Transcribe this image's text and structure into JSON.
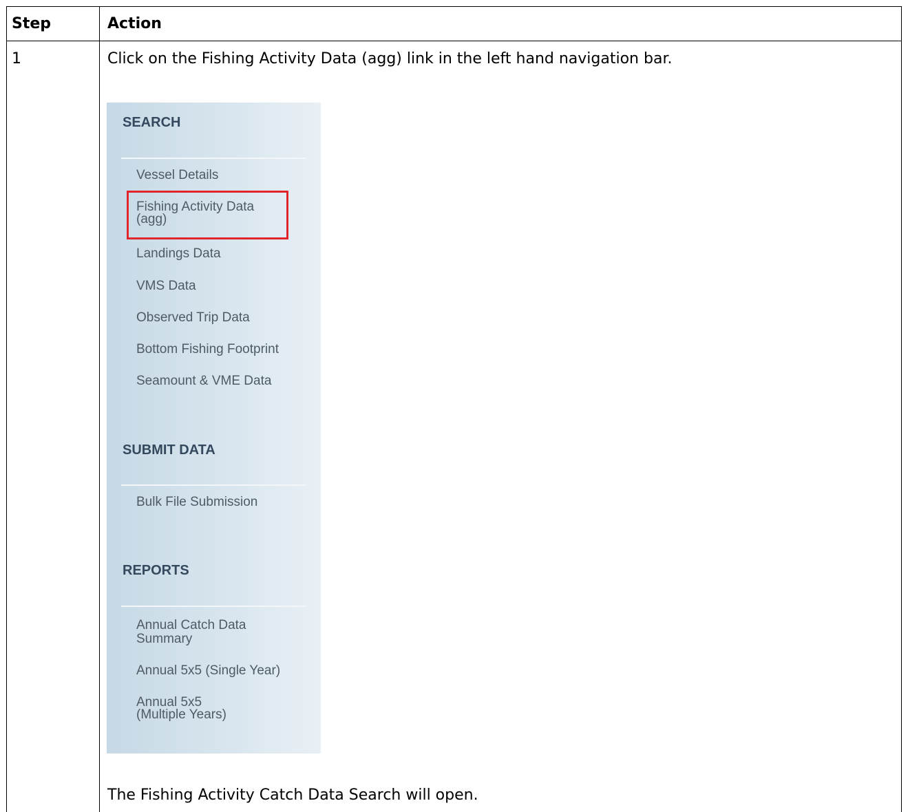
{
  "table": {
    "header": {
      "step": "Step",
      "action": "Action"
    },
    "row": {
      "step": "1",
      "instruction": "Click on the Fishing Activity Data (agg) link in the left hand navigation bar.",
      "result": "The Fishing Activity Catch Data Search will open."
    }
  },
  "nav": {
    "search": {
      "title": "SEARCH",
      "items": [
        "Vessel Details",
        "Fishing Activity Data",
        "(agg)",
        "Landings Data",
        "VMS Data",
        "Observed Trip Data",
        "Bottom Fishing Footprint",
        "Seamount & VME Data"
      ]
    },
    "submit": {
      "title": "SUBMIT DATA",
      "items": [
        "Bulk File Submission"
      ]
    },
    "reports": {
      "title": "REPORTS",
      "items": [
        "Annual Catch Data",
        "Summary",
        "Annual 5x5 (Single Year)",
        "Annual 5x5",
        "(Multiple Years)"
      ]
    },
    "highlight_color": "#e0252c",
    "background_color": "#d3e2ec"
  }
}
